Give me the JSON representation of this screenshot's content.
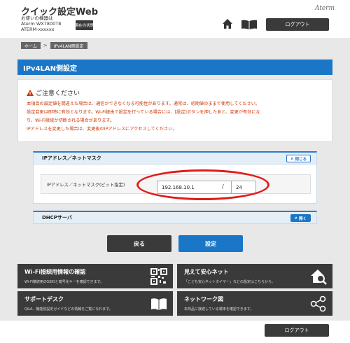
{
  "header": {
    "app_title": "クイック設定Web",
    "device_line1": "お使いの機器は",
    "device_line2": "Aterm WX7800T8",
    "device_line3": "ATERM-xxxxxx",
    "status_button": "現在の状態",
    "brand": "Aterm",
    "logout_label": "ログアウト"
  },
  "breadcrumb": {
    "home": "ホーム",
    "separator": ">",
    "current": "IPv4LAN側設定"
  },
  "page_title": "IPv4LAN側設定",
  "notice": {
    "title": "ご注意ください",
    "lines": [
      "本項目の設定値を間違えた場合は、通信ができなくなる可能性があります。通常は、初期値のままで使用してください。",
      "設定変更は即時に有効となります。Wi-Fi経由で設定を行っている場合には、[設定]ボタンを押したあと、変更が有効にな",
      "り、Wi-Fi接続が切断される場合があります。",
      "IPアドレスを変更した場合は、変更後のIPアドレスにアクセスしてください。"
    ]
  },
  "ip_section": {
    "title": "IPアドレス／ネットマスク",
    "toggle_label": "閉じる",
    "field_label": "IPアドレス／ネットマスク(ビット指定)",
    "ip_value": "192.168.10.1",
    "slash": "/",
    "mask_value": "24"
  },
  "dhcp_section": {
    "title": "DHCPサーバ",
    "toggle_label": "開く"
  },
  "buttons": {
    "back": "戻る",
    "set": "設定"
  },
  "cards": [
    {
      "title": "Wi-Fi接続用情報の確認",
      "desc": "Wi-Fi接続用のSSIDと暗号化キーを確認できます。",
      "icon": "qr-code-icon"
    },
    {
      "title": "見えて安心ネット",
      "desc": "「こども安心ネットタイマー」などの設定はこちらから。",
      "icon": "home-search-icon"
    },
    {
      "title": "サポートデスク",
      "desc": "Q&A、機能別設定ガイドなどの情報をご覧になれます。",
      "icon": "book-icon"
    },
    {
      "title": "ネットワーク図",
      "desc": "本商品に接続している端末を確認できます。",
      "icon": "network-icon"
    }
  ],
  "colors": {
    "accent_blue": "#1a76c7",
    "dark_button": "#3a3a3a",
    "warning_text": "#cc3300",
    "highlight_red": "#e21b1b"
  }
}
